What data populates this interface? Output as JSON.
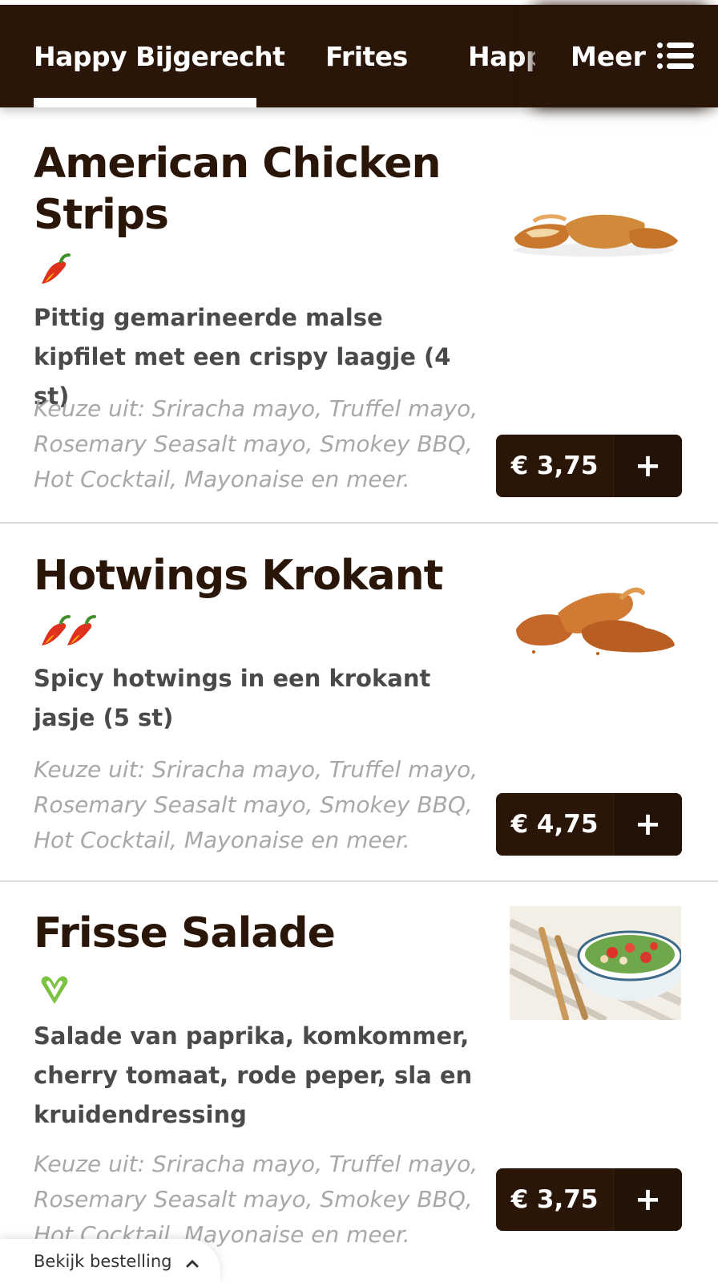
{
  "nav": {
    "tabs": [
      {
        "label": "Happy Bijgerecht",
        "active": true
      },
      {
        "label": "Frites",
        "active": false
      },
      {
        "label": "Happy",
        "active": false
      }
    ],
    "more_label": "Meer",
    "more_icon": "list-icon"
  },
  "items": [
    {
      "title": "American Chicken Strips",
      "spice_icon": "chili-pepper-icon",
      "spice_level": 1,
      "description": "Pittig gemarineerde malse kipfilet met een crispy laagje (4 st)",
      "choice": "Keuze uit: Sriracha mayo, Truffel mayo, Rosemary Seasalt mayo, Smokey BBQ, Hot Cocktail, Mayonaise en meer.",
      "price": "€ 3,75",
      "add_label": "+"
    },
    {
      "title": "Hotwings Krokant",
      "spice_icon": "chili-pepper-icon",
      "spice_level": 2,
      "description": "Spicy hotwings in een krokant jasje (5 st)",
      "choice": "Keuze uit: Sriracha mayo, Truffel mayo, Rosemary Seasalt mayo, Smokey BBQ, Hot Cocktail, Mayonaise en meer.",
      "price": "€ 4,75",
      "add_label": "+"
    },
    {
      "title": "Frisse Salade",
      "diet_icon": "vegan-icon",
      "description": "Salade van paprika, komkommer, cherry tomaat, rode peper, sla en kruidendressing",
      "choice": "Keuze uit: Sriracha mayo, Truffel mayo, Rosemary Seasalt mayo, Smokey BBQ, Hot Cocktail, Mayonaise en meer.",
      "price": "€ 3,75",
      "add_label": "+"
    }
  ],
  "order_bar": {
    "label": "Bekijk bestelling",
    "icon": "chevron-up-icon"
  },
  "colors": {
    "brand_dark": "#2a1609",
    "vegan_green": "#7cc242",
    "chili_red": "#e0301e"
  }
}
